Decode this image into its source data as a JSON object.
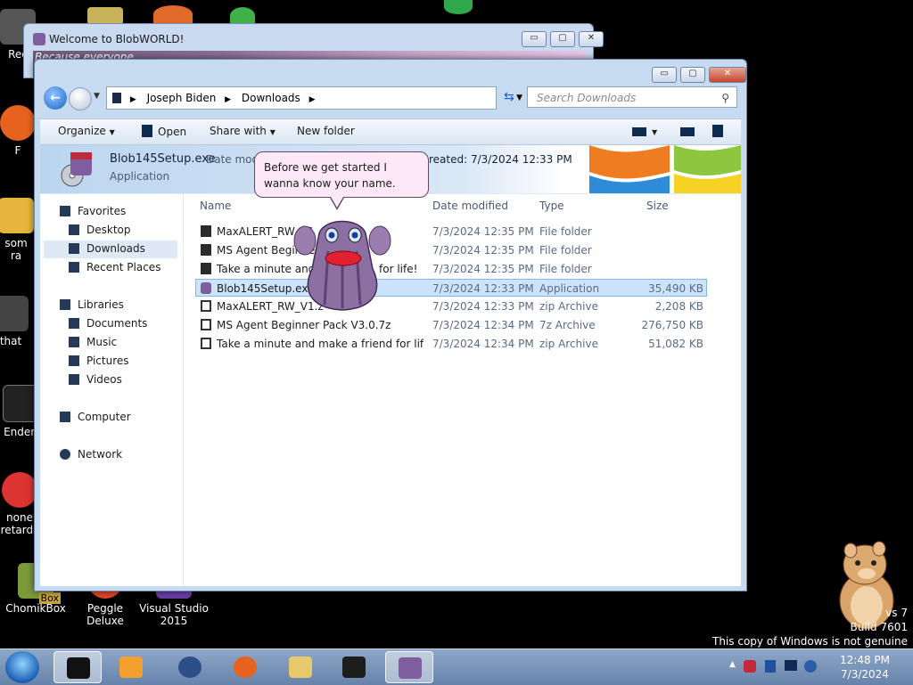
{
  "desktop": {
    "icons": [
      {
        "label": "Rec"
      },
      {
        "label": "F"
      },
      {
        "label": "som\nra"
      },
      {
        "label": "that"
      },
      {
        "label": "Enderr"
      },
      {
        "label": "none\nretards"
      },
      {
        "label": "ChomikBox"
      },
      {
        "label": "Peggle Deluxe"
      },
      {
        "label": "Visual Studio\n2015"
      }
    ],
    "box_label": "Box"
  },
  "bg_window": {
    "title": "Welcome to BlobWORLD!",
    "strip_text": "Because everyone",
    "min": "▭",
    "max": "▢",
    "close": "✕"
  },
  "explorer": {
    "window_buttons": {
      "min": "▭",
      "max": "▢",
      "close": "✕"
    },
    "breadcrumb": [
      "Joseph Biden",
      "Downloads"
    ],
    "search_placeholder": "Search Downloads",
    "toolbar": {
      "organize": "Organize",
      "open": "Open",
      "share_with": "Share with",
      "new_folder": "New folder"
    },
    "details": {
      "file_name": "Blob145Setup.exe",
      "file_type": "Application",
      "date_modified_label": "Date modi",
      "date_created_label": "reated:",
      "date_created_value": "7/3/2024 12:33 PM"
    },
    "nav": {
      "favorites": "Favorites",
      "desktop": "Desktop",
      "downloads": "Downloads",
      "recent": "Recent Places",
      "libraries": "Libraries",
      "documents": "Documents",
      "music": "Music",
      "pictures": "Pictures",
      "videos": "Videos",
      "computer": "Computer",
      "network": "Network"
    },
    "columns": {
      "name": "Name",
      "date": "Date modified",
      "type": "Type",
      "size": "Size"
    },
    "files": [
      {
        "name": "MaxALERT_RW_V1",
        "date": "7/3/2024 12:35 PM",
        "type": "File folder",
        "size": ""
      },
      {
        "name": "MS Agent Beginner",
        "date": "7/3/2024 12:35 PM",
        "type": "File folder",
        "size": ""
      },
      {
        "name": "Take a minute and",
        "name_tail": "for life!",
        "date": "7/3/2024 12:35 PM",
        "type": "File folder",
        "size": ""
      },
      {
        "name": "Blob145Setup.exe",
        "date": "7/3/2024 12:33 PM",
        "type": "Application",
        "size": "35,490 KB"
      },
      {
        "name": "MaxALERT_RW_V1.z",
        "date": "7/3/2024 12:33 PM",
        "type": "zip Archive",
        "size": "2,208 KB"
      },
      {
        "name": "MS Agent Beginner Pack V3.0.7z",
        "date": "7/3/2024 12:34 PM",
        "type": "7z Archive",
        "size": "276,750 KB"
      },
      {
        "name": "Take a minute and make a friend for life!....",
        "date": "7/3/2024 12:34 PM",
        "type": "zip Archive",
        "size": "51,082 KB"
      }
    ]
  },
  "balloon": {
    "text": "Before we get started I wanna know your name."
  },
  "genuine": {
    "line1": "vs 7",
    "line2": "Build 7601",
    "line3": "This copy of Windows is not genuine"
  },
  "clock": {
    "time": "12:48 PM",
    "date": "7/3/2024"
  }
}
